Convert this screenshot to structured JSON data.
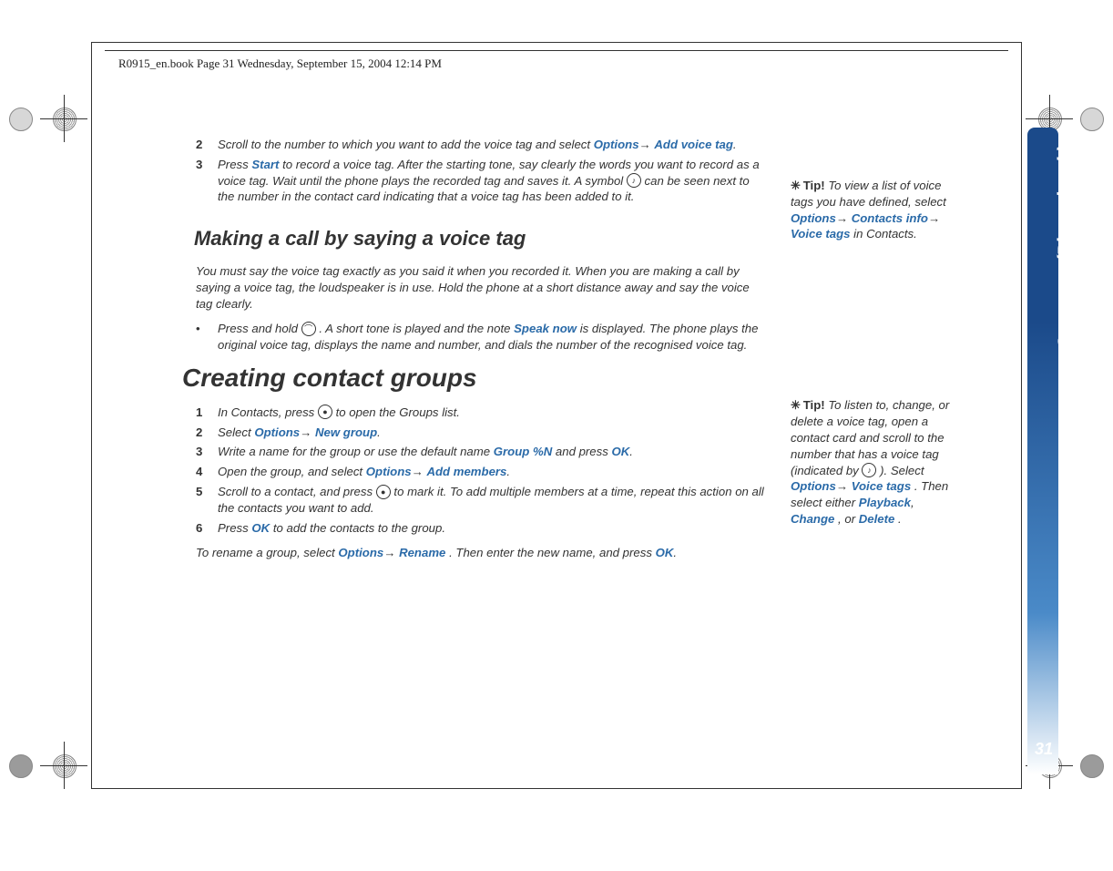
{
  "header": "R0915_en.book  Page 31  Wednesday, September 15, 2004  12:14 PM",
  "sidebar_label": "Contacts (Phonebook)",
  "page_number": "31",
  "steps_a": {
    "s2_a": "Scroll to the number to which you want to add the voice tag and select ",
    "s2_opt": "Options",
    "s2_add": "Add voice tag",
    "s3_a": "Press ",
    "s3_start": "Start",
    "s3_b": " to record a voice tag. After the starting tone, say clearly the words you want to record as a voice tag. Wait until the phone plays the recorded tag and saves it. A symbol ",
    "s3_c": " can be seen next to the number in the contact card indicating that a voice tag has been added to it."
  },
  "h2_making": "Making a call by saying a voice tag",
  "para_making": "You must say the voice tag exactly as you said it when you recorded it. When you are making a call by saying a voice tag, the loudspeaker is in use. Hold the phone at a short distance away and say the voice tag clearly.",
  "bullet_making": {
    "a": "Press and hold ",
    "b": ". A short tone is played and the note ",
    "speak": "Speak now",
    "c": " is displayed. The phone plays the original voice tag, displays the name and number, and dials the number of the recognised voice tag."
  },
  "h1_groups": "Creating contact groups",
  "steps_b": {
    "s1_a": "In Contacts, press ",
    "s1_b": " to open the Groups list.",
    "s2_a": "Select ",
    "s2_opt": "Options",
    "s2_new": "New group",
    "s3_a": "Write a name for the group or use the default name ",
    "s3_groupn": "Group %N",
    "s3_b": " and press ",
    "s3_ok": "OK",
    "s4_a": "Open the group, and select ",
    "s4_opt": "Options",
    "s4_add": "Add members",
    "s5_a": "Scroll to a contact, and press ",
    "s5_b": " to mark it. To add multiple members at a time, repeat this action on all the contacts you want to add.",
    "s6_a": "Press ",
    "s6_ok": "OK",
    "s6_b": " to add the contacts to the group."
  },
  "rename": {
    "a": "To rename a group, select ",
    "opt": "Options",
    "ren": "Rename",
    "b": ". Then enter the new name, and press ",
    "ok": "OK"
  },
  "tip1": {
    "tip": "Tip!",
    "a": " To view a list of voice tags you have defined, select ",
    "opt": "Options",
    "ci": "Contacts info",
    "vt": "Voice tags",
    "b": " in Contacts."
  },
  "tip2": {
    "tip": "Tip!",
    "a": " To listen to, change, or delete a voice tag, open a contact card and scroll to the number that has a voice tag (indicated by ",
    "b": "). Select ",
    "opt": "Options",
    "vt": "Voice tags",
    "c": ". Then select either ",
    "pb": "Playback",
    "ch": "Change",
    "d": ", or ",
    "del": "Delete",
    "e": "."
  }
}
